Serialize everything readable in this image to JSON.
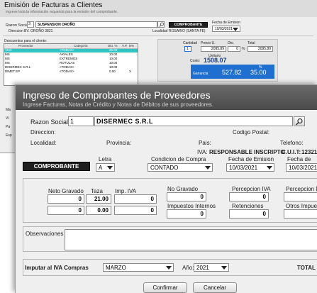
{
  "back_window": {
    "title": "Emisión de Facturas a Clientes",
    "subtitle": "Ingrese toda la información requerida para la emisión del comprobante.",
    "razon_social_label": "Razon Social:",
    "razon_social_code": "3",
    "razon_social_value": "SUSPENSION OROÑO",
    "comprobante_button": "COMPROBANTE",
    "fecha_emision_label": "Fecha de Emision",
    "fecha_emision_value": "10/03/2021",
    "direccion_label": "Direccion",
    "direccion_value": "BV. OROÑO 3821",
    "localidad_label": "Localidad",
    "localidad_value": "ROSARIO (SANTA FE)",
    "descuentos_label": "Descuentos para el cliente:",
    "table_headers": [
      "Proveedor",
      "Categoria",
      "Dto. %",
      "V.P.",
      "B%"
    ],
    "table_rows": [
      {
        "proveedor": "VKO",
        "categoria": "<TODAS>",
        "dto": "25.00"
      },
      {
        "proveedor": "MS",
        "categoria": "AXIALES",
        "dto": "10.00"
      },
      {
        "proveedor": "MS",
        "categoria": "EXTREMOS",
        "dto": "10.00"
      },
      {
        "proveedor": "MS",
        "categoria": "ROTULAS",
        "dto": "10.00"
      },
      {
        "proveedor": "DISERMEC S.R.L",
        "categoria": "<TODAS>",
        "dto": "10.00"
      },
      {
        "proveedor": "DIMET EP",
        "categoria": "<TODAS>",
        "dto": "0.00",
        "vp": "X"
      }
    ],
    "cantidad_label": "Cantidad",
    "cantidad_value": "1",
    "precio_label": "Precio U.",
    "precio_value": "2095.89",
    "dto_label": "Dto.",
    "dto_value": "0",
    "total_label": "Total",
    "total_value": "2095.89",
    "unitario_label": "Unitario",
    "costo_label": "Costo:",
    "costo_value": "1508.07",
    "ganancia_label": "Ganancia",
    "ganancia_value": "527.82",
    "ganancia_pct_label": "%",
    "ganancia_pct_value": "35.00",
    "left_stub_labels": [
      "Ma",
      "Vi",
      "Pa",
      "Esp"
    ]
  },
  "main_window": {
    "title": "Ingreso de Comprobantes de Proveedores",
    "subtitle": "Ingrese Facturas, Notas de Crédito y Notas de Débitos de sus proveedores.",
    "razon_social_label": "Razon Social:",
    "razon_social_code": "1",
    "razon_social_value": "DISERMEC S.R.L",
    "direccion_label": "Direccion:",
    "codigo_postal_label": "Codigo Postal:",
    "localidad_label": "Localidad:",
    "provincia_label": "Provincia:",
    "pais_label": "Pais:",
    "telefono_label": "Telefono:",
    "iva_label": "IVA:",
    "iva_value": "RESPONSABLE INSCRIPTO",
    "cuit_label": "C.U.I.T:",
    "cuit_value": "12321",
    "comprobante_button": "COMPROBANTE",
    "letra_label": "Letra",
    "letra_value": "A",
    "condicion_label": "Condicion de Compra",
    "condicion_value": "CONTADO",
    "fecha_emision_label": "Fecha de Emision",
    "fecha_emision_value": "10/03/2021",
    "fecha_2_label": "Fecha de",
    "fecha_2_value": "10/03/2021",
    "neto_gravado_label": "Neto Gravado",
    "taza_label": "Taza",
    "imp_iva_label": "Imp. IVA",
    "row1": {
      "neto": "0",
      "taza": "21.00",
      "iva": "0"
    },
    "row2": {
      "neto": "0",
      "taza": "0.00",
      "iva": "0"
    },
    "no_gravado_label": "No Gravado",
    "no_gravado_value": "0",
    "percepcion_iva_label": "Percepcion IVA",
    "percepcion_iva_value": "0",
    "percepcion_d_label": "Percepcion D",
    "impuestos_internos_label": "Impuestos Internos",
    "impuestos_internos_value": "0",
    "retenciones_label": "Retenciones",
    "retenciones_value": "0",
    "otros_impuestos_label": "Otros Impue",
    "observaciones_label": "Observaciones",
    "imputar_label": "Imputar al IVA Compras",
    "mes_value": "MARZO",
    "anio_label": "Año:",
    "anio_value": "2021",
    "total_label": "TOTAL",
    "confirmar_label": "Confirmar",
    "cancelar_label": "Cancelar"
  }
}
